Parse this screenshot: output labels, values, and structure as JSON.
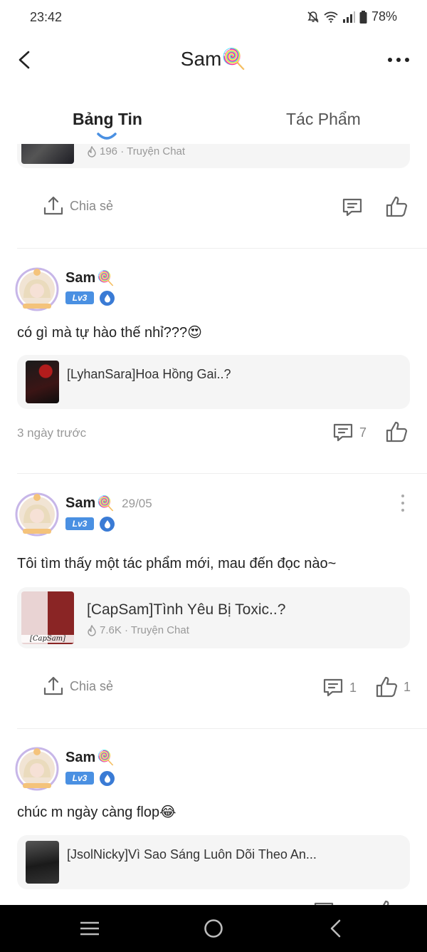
{
  "status_bar": {
    "time": "23:42",
    "battery": "78%"
  },
  "header": {
    "title": "Sam",
    "title_emoji": "🍭"
  },
  "tabs": [
    {
      "label": "Bảng Tin",
      "active": true
    },
    {
      "label": "Tác Phẩm",
      "active": false
    }
  ],
  "feed": {
    "post0": {
      "card": {
        "meta": "196 · Truyện Chat"
      },
      "share_label": "Chia sẻ"
    },
    "post1": {
      "author": "Sam",
      "author_emoji": "🍭",
      "level": "Lv3",
      "text": "có gì mà tự hào thế nhỉ???😍",
      "card": {
        "title": "[LyhanSara]Hoa Hồng Gai..?"
      },
      "time": "3 ngày trước",
      "comments": "7"
    },
    "post2": {
      "author": "Sam",
      "author_emoji": "🍭",
      "date": "29/05",
      "level": "Lv3",
      "text": "Tôi tìm thấy một tác phẩm mới, mau đến đọc nào~",
      "card": {
        "title": "[CapSam]Tình Yêu Bị Toxic..?",
        "meta": "7.6K · Truyện Chat",
        "cover_caption": "[CapSam]"
      },
      "share_label": "Chia sẻ",
      "comments": "1",
      "likes": "1"
    },
    "post3": {
      "author": "Sam",
      "author_emoji": "🍭",
      "level": "Lv3",
      "text": "chúc m ngày càng flop😂",
      "card": {
        "title": "[JsolNicky]Vì Sao Sáng Luôn Dõi Theo An..."
      }
    }
  },
  "colors": {
    "accent": "#4a90e2",
    "badge": "#3a7bd5",
    "card_bg": "#f5f5f5",
    "muted": "#999999"
  }
}
